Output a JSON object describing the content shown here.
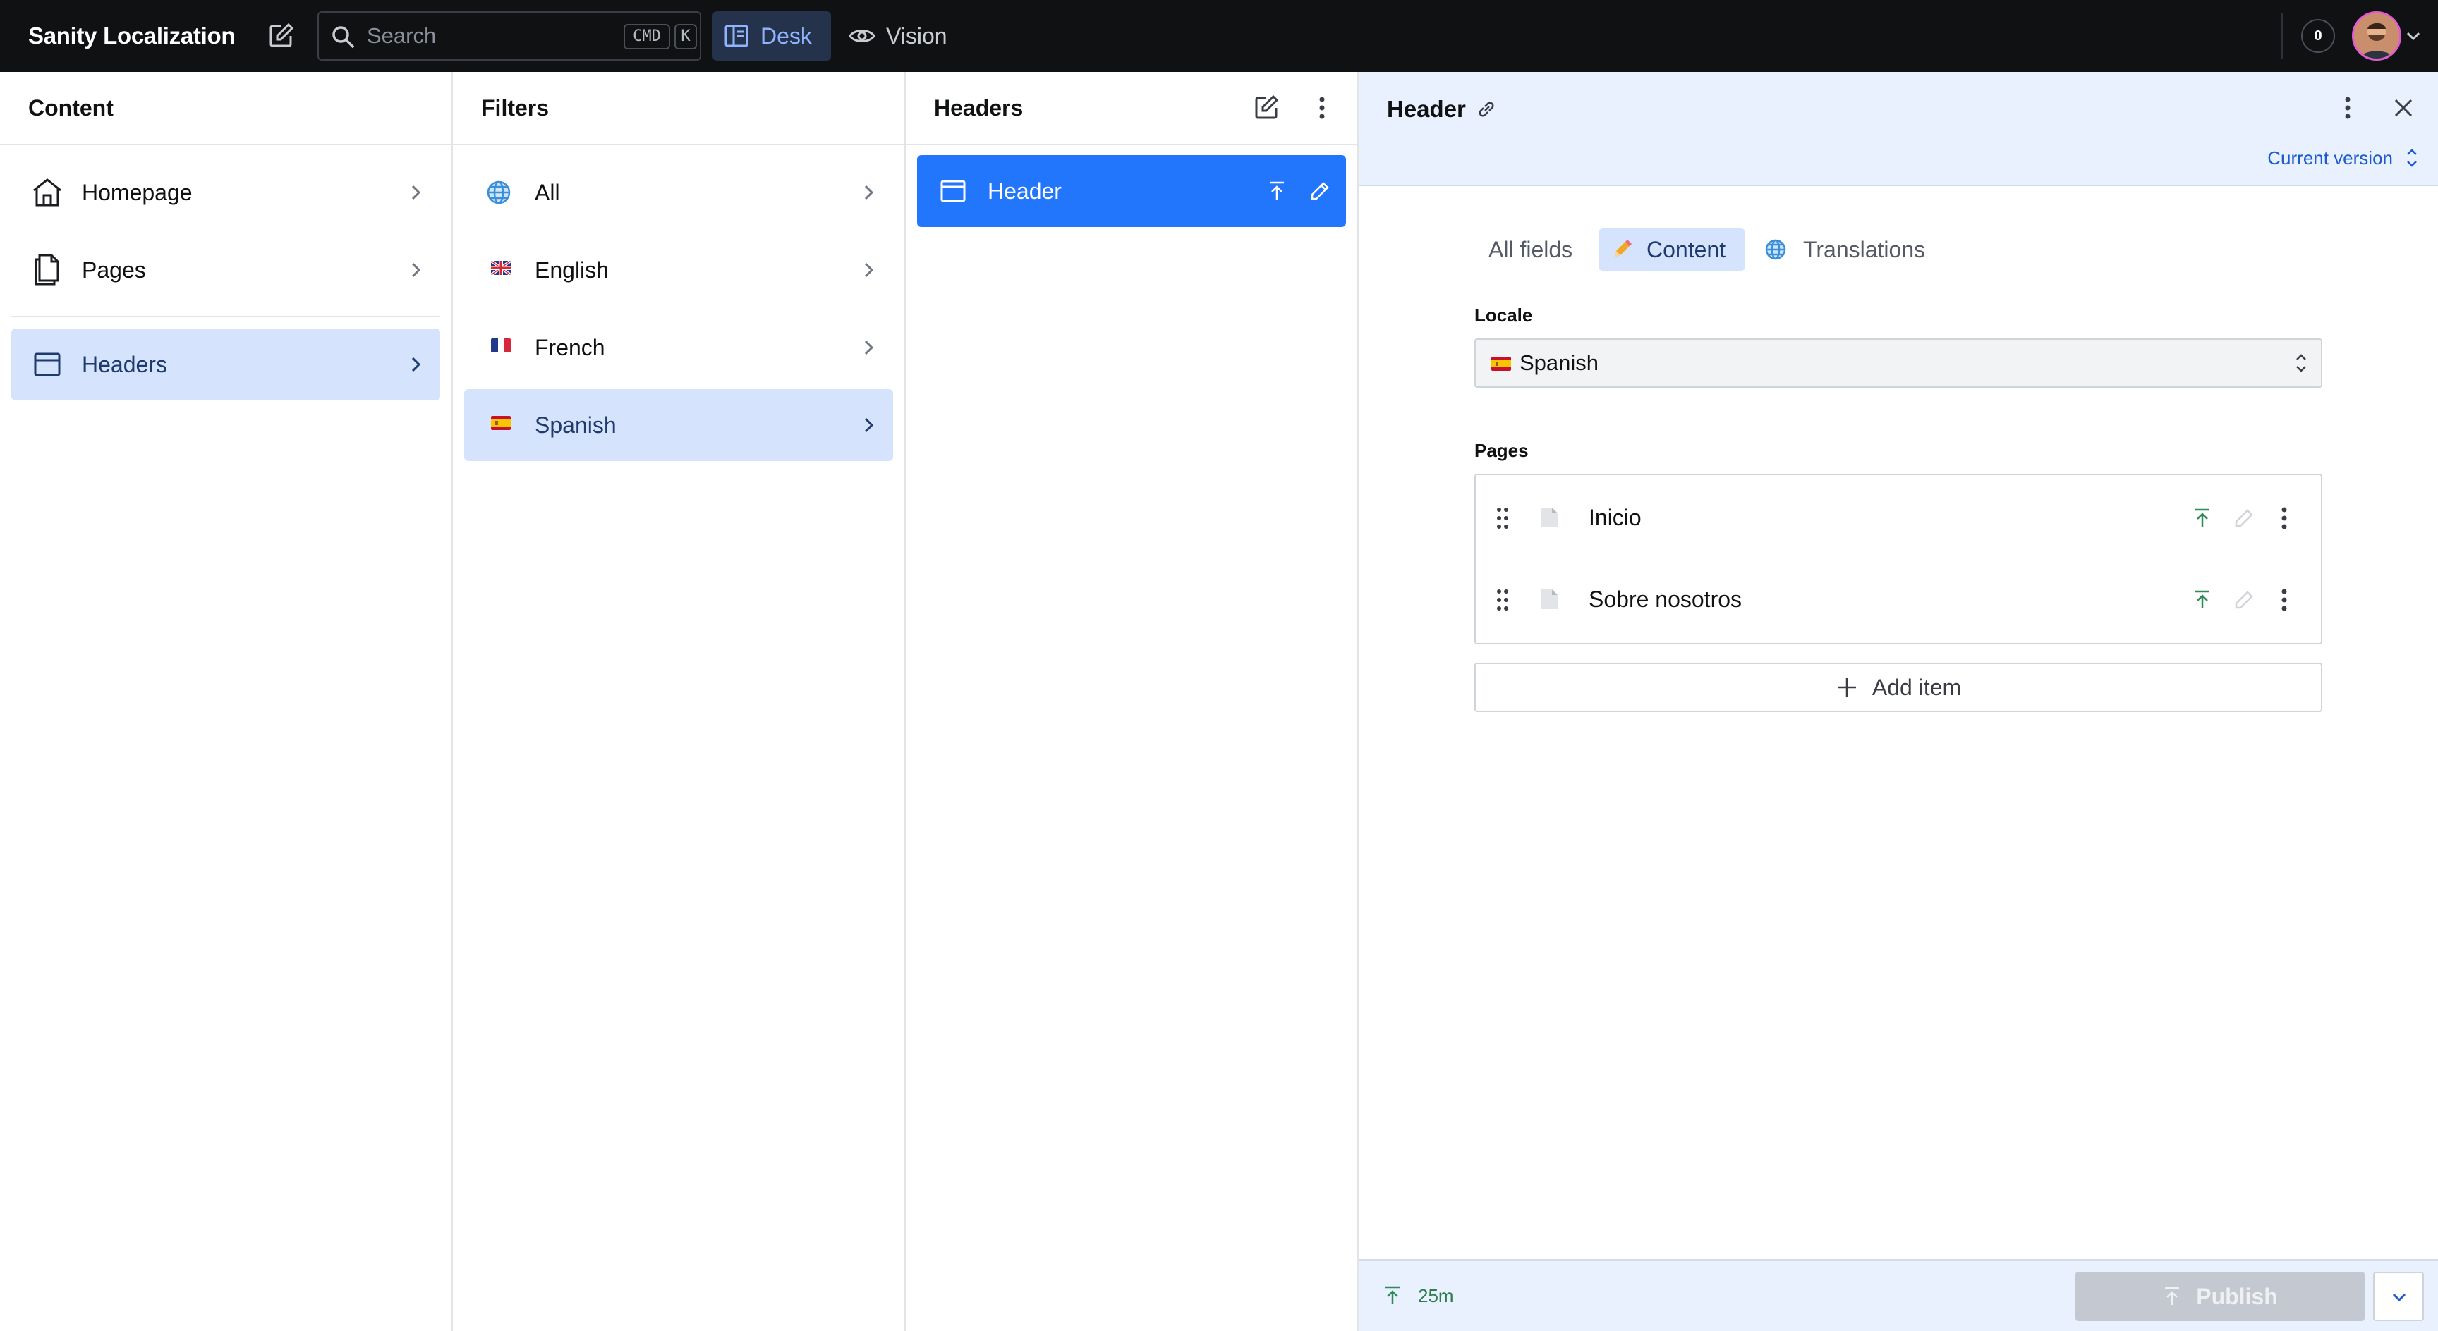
{
  "app": {
    "title": "Sanity Localization",
    "search_placeholder": "Search",
    "shortcut_keys": [
      "CMD",
      "K"
    ],
    "tools": [
      {
        "label": "Desk",
        "icon": "desk-icon",
        "active": true
      },
      {
        "label": "Vision",
        "icon": "eye-icon",
        "active": false
      }
    ],
    "notification_count": "0",
    "accent": "#2276fc",
    "topbar_bg": "#101112"
  },
  "content_pane": {
    "title": "Content",
    "items": [
      {
        "label": "Homepage",
        "icon": "home-icon"
      },
      {
        "label": "Pages",
        "icon": "documents-icon"
      },
      {
        "label": "Headers",
        "icon": "header-doc-icon",
        "selected": true
      }
    ]
  },
  "filters_pane": {
    "title": "Filters",
    "items": [
      {
        "label": "All",
        "icon": "globe-icon"
      },
      {
        "label": "English",
        "icon": "uk-flag-icon"
      },
      {
        "label": "French",
        "icon": "france-flag-icon"
      },
      {
        "label": "Spanish",
        "icon": "spain-flag-icon",
        "selected": true
      }
    ]
  },
  "headers_pane": {
    "title": "Headers",
    "items": [
      {
        "label": "Header",
        "icon": "header-doc-icon",
        "selected": true
      }
    ]
  },
  "editor": {
    "title": "Header",
    "version": "Current version",
    "tabs": [
      {
        "label": "All fields",
        "icon": "",
        "active": false
      },
      {
        "label": "Content",
        "icon": "pencil-emoji-icon",
        "active": true
      },
      {
        "label": "Translations",
        "icon": "globe-icon",
        "active": false
      }
    ],
    "locale": {
      "label": "Locale",
      "value": "Spanish"
    },
    "pages": {
      "label": "Pages",
      "items": [
        {
          "name": "Inicio"
        },
        {
          "name": "Sobre nosotros"
        }
      ],
      "add_label": "Add item"
    },
    "footer": {
      "published_ago": "25m",
      "publish_label": "Publish"
    }
  }
}
